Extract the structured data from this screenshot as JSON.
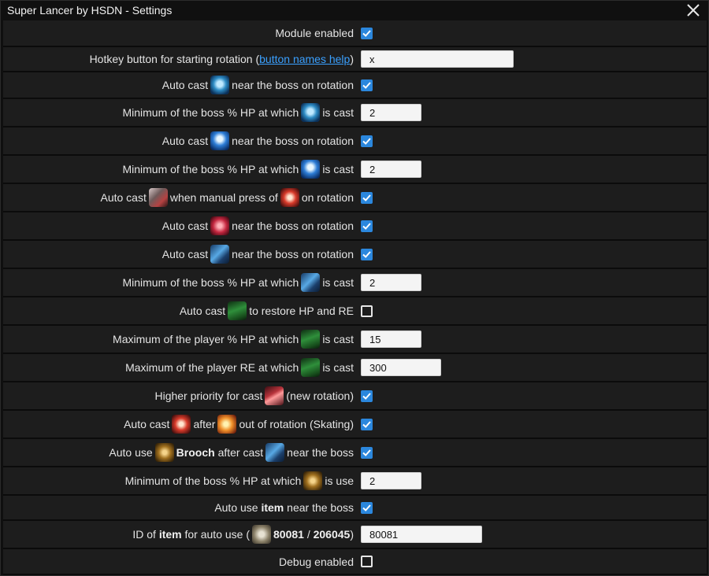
{
  "window": {
    "title": "Super Lancer by HSDN - Settings"
  },
  "rows": [
    {
      "label": "Module enabled",
      "checked": true
    },
    {
      "label_pre": "Hotkey button for starting rotation (",
      "link": "button names help",
      "label_post": ")",
      "value": "x"
    },
    {
      "label_pre": "Auto cast",
      "icon": "blue-aura-skill-icon",
      "label_post": "near the boss on rotation",
      "checked": true
    },
    {
      "label_pre": "Minimum of the boss % HP at which",
      "icon": "blue-aura-skill-icon",
      "label_post": "is cast",
      "value": "2"
    },
    {
      "label_pre": "Auto cast",
      "icon": "blue-shield-skill-icon",
      "label_post": "near the boss on rotation",
      "checked": true
    },
    {
      "label_pre": "Minimum of the boss % HP at which",
      "icon": "blue-shield-skill-icon",
      "label_post": "is cast",
      "value": "2"
    },
    {
      "label_pre": "Auto cast",
      "icon": "spear-skill-icon",
      "label_mid": "when manual press of",
      "icon2": "red-burst-skill-icon",
      "label_post": "on rotation",
      "checked": true
    },
    {
      "label_pre": "Auto cast",
      "icon": "red-roar-skill-icon",
      "label_post": "near the boss on rotation",
      "checked": true
    },
    {
      "label_pre": "Auto cast",
      "icon": "blue-lancer-skill-icon",
      "label_post": "near the boss on rotation",
      "checked": true
    },
    {
      "label_pre": "Minimum of the boss % HP at which",
      "icon": "blue-lancer-skill-icon",
      "label_post": "is cast",
      "value": "2"
    },
    {
      "label_pre": "Auto cast",
      "icon": "green-skill-icon",
      "label_post": "to restore HP and RE",
      "checked": false
    },
    {
      "label_pre": "Maximum of the player % HP at which",
      "icon": "green-skill-icon",
      "label_post": "is cast",
      "value": "15"
    },
    {
      "label_pre": "Maximum of the player RE at which",
      "icon": "green-skill-icon",
      "label_post": "is cast",
      "value": "300"
    },
    {
      "label_pre": "Higher priority for cast",
      "icon": "red-wave-skill-icon",
      "label_post": "(new rotation)",
      "checked": true
    },
    {
      "label_pre": "Auto cast",
      "icon": "red-burst-skill-icon",
      "label_mid": "after",
      "icon2": "fire-skill-icon",
      "label_post": "out of rotation (Skating)",
      "checked": true
    },
    {
      "label_pre": "Auto use",
      "icon": "brooch-icon",
      "bold1": "Brooch",
      "label_mid": "after cast",
      "icon2": "blue-lancer-skill-icon",
      "label_post": "near the boss",
      "checked": true
    },
    {
      "label_pre": "Minimum of the boss % HP at which",
      "icon": "brooch-icon",
      "label_post": "is use",
      "value": "2"
    },
    {
      "label_pre": "Auto use",
      "bold1": "item",
      "label_post": "near the boss",
      "checked": true
    },
    {
      "label_pre": "ID of",
      "bold1": "item",
      "label_mid": "for auto use (",
      "icon": "item-icon",
      "bold2": "80081",
      "label_sep": "/",
      "bold3": "206045",
      "label_post": ")",
      "value": "80081"
    },
    {
      "label": "Debug enabled",
      "checked": false
    }
  ]
}
